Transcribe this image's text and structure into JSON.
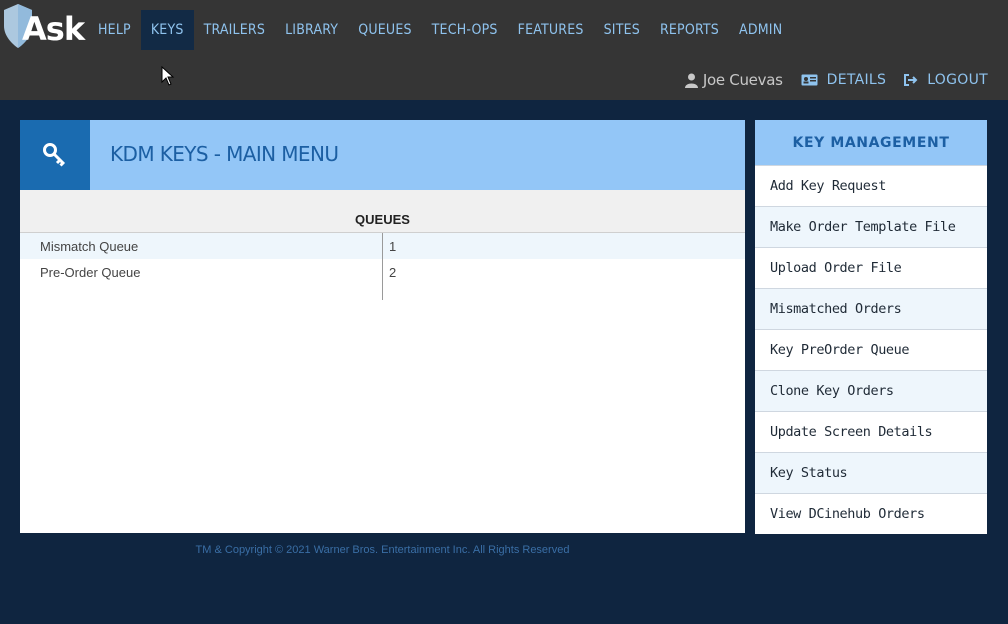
{
  "app": {
    "logo_text": "Ask"
  },
  "nav": {
    "items": [
      {
        "label": "HELP"
      },
      {
        "label": "KEYS",
        "active": true
      },
      {
        "label": "TRAILERS"
      },
      {
        "label": "LIBRARY"
      },
      {
        "label": "QUEUES"
      },
      {
        "label": "TECH-OPS"
      },
      {
        "label": "FEATURES"
      },
      {
        "label": "SITES"
      },
      {
        "label": "REPORTS"
      },
      {
        "label": "ADMIN"
      }
    ]
  },
  "user": {
    "name": "Joe Cuevas",
    "details_label": "DETAILS",
    "logout_label": "LOGOUT"
  },
  "main": {
    "title": "KDM KEYS - MAIN MENU",
    "icon": "key-icon",
    "queues_title": "QUEUES",
    "rows": [
      {
        "name": "Mismatch Queue",
        "value": "1"
      },
      {
        "name": "Pre-Order Queue",
        "value": "2"
      }
    ]
  },
  "sidebar": {
    "title": "KEY MANAGEMENT",
    "items": [
      {
        "label": "Add Key Request"
      },
      {
        "label": "Make Order Template File"
      },
      {
        "label": "Upload Order File"
      },
      {
        "label": "Mismatched Orders"
      },
      {
        "label": "Key PreOrder Queue"
      },
      {
        "label": "Clone Key Orders"
      },
      {
        "label": "Update Screen Details"
      },
      {
        "label": "Key Status"
      },
      {
        "label": "View DCinehub Orders"
      }
    ]
  },
  "footer": {
    "text": "TM & Copyright © 2021 Warner Bros. Entertainment Inc. All Rights Reserved"
  },
  "colors": {
    "header_bg": "#353535",
    "page_bg": "#0f2540",
    "accent": "#93c6f7",
    "accent_dark": "#1a6bb0",
    "nav_text": "#8fc3ee"
  }
}
